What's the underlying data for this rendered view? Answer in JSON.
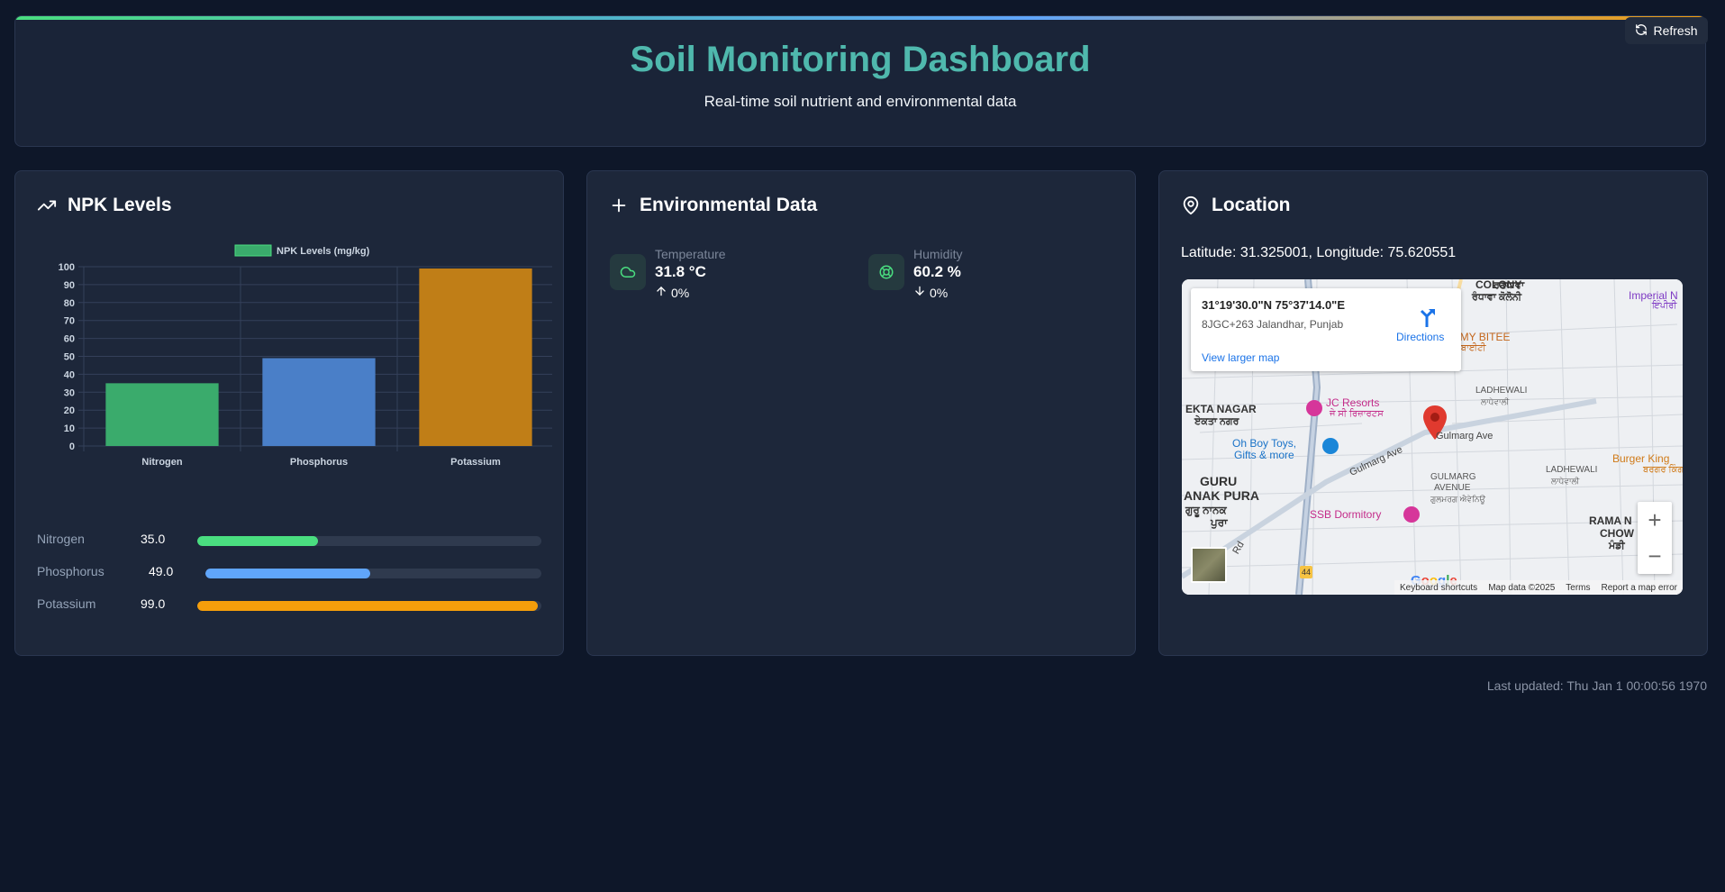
{
  "header": {
    "title": "Soil Monitoring Dashboard",
    "subtitle": "Real-time soil nutrient and environmental data",
    "refresh_label": "Refresh"
  },
  "npk_card": {
    "title": "NPK Levels",
    "items": [
      {
        "name": "Nitrogen",
        "value": "35.0",
        "percent": 35,
        "color": "#4ade80"
      },
      {
        "name": "Phosphorus",
        "value": "49.0",
        "percent": 49,
        "color": "#60a5fa"
      },
      {
        "name": "Potassium",
        "value": "99.0",
        "percent": 99,
        "color": "#f59e0b"
      }
    ]
  },
  "chart_data": {
    "type": "bar",
    "categories": [
      "Nitrogen",
      "Phosphorus",
      "Potassium"
    ],
    "series": [
      {
        "name": "NPK Levels (mg/kg)",
        "values": [
          35,
          49,
          99
        ],
        "colors": [
          "#3aab6c",
          "#4a7fc8",
          "#c07e17"
        ]
      }
    ],
    "yticks": [
      0,
      10,
      20,
      30,
      40,
      50,
      60,
      70,
      80,
      90,
      100
    ],
    "ylim": [
      0,
      100
    ],
    "grid": true,
    "legend": "top"
  },
  "env_card": {
    "title": "Environmental Data",
    "items": [
      {
        "label": "Temperature",
        "value": "31.8 °C",
        "trend": "0%",
        "direction": "up",
        "icon": "cloud-icon"
      },
      {
        "label": "Humidity",
        "value": "60.2 %",
        "trend": "0%",
        "direction": "down",
        "icon": "lifebuoy-icon"
      }
    ]
  },
  "location_card": {
    "title": "Location",
    "coordinates_text": "Latitude: 31.325001, Longitude: 75.620551",
    "map": {
      "info_coords": "31°19'30.0\"N 75°37'14.0\"E",
      "info_address": "8JGC+263 Jalandhar, Punjab",
      "directions_label": "Directions",
      "view_larger_label": "View larger map",
      "google_logo": "Google",
      "footer": [
        "Keyboard shortcuts",
        "Map data ©2025",
        "Terms",
        "Report a map error"
      ],
      "zoom_in": "+",
      "zoom_out": "−",
      "labels": {
        "colony": "COLONY",
        "colony_pa": "ਰੰਧਾਵਾ ਕੋਲੋਨੀ",
        "imperial": "Imperial N",
        "imperial_pa": "ਇੰਪੀਰੀ",
        "yummy": "YUMMY BITEE",
        "yummy_pa": "ਯੰਮੀ ਬਾਈਟੀ",
        "ladhewali1": "LADHEWALI",
        "ladhewali1_pa": "ਲਾਧੇਵਾਲੀ",
        "jc": "JC Resorts",
        "jc_pa": "ਜੇ ਸੀ ਰਿਜ਼ਾਰਟਸ",
        "ekta": "EKTA NAGAR",
        "ekta_pa": "ਏਕਤਾ ਨਗਰ",
        "ohboy1": "Oh Boy Toys,",
        "ohboy2": "Gifts & more",
        "gulmarg_ave": "Gulmarg Ave",
        "gulmarg_ave2": "Gulmarg Ave",
        "gulmarg_avenue1": "GULMARG",
        "gulmarg_avenue2": "AVENUE",
        "gulmarg_avenue_pa": "ਗੁਲਮਰਗ ਐਵੇਨਿਊ",
        "guru1": "GURU",
        "guru2": "ANAK PURA",
        "guru_pa1": "ਗੁਰੂ ਨਾਨਕ",
        "guru_pa2": "ਪੁਰਾ",
        "ssb": "SSB Dormitory",
        "burger": "Burger King",
        "burger_pa": "ਬਰਗਰ ਕਿੰਗ",
        "ladhewali2": "LADHEWALI",
        "ladhewali2_pa": "ਲਾਧੇਵਾਲੀ",
        "rama1": "RAMA N",
        "rama2": "CHOW",
        "rama_pa": "ਮੰਡੀ",
        "rd": "Rd",
        "hwy": "44",
        "top_cut": "ਰਣਧਾਵਾ"
      }
    }
  },
  "footer": {
    "last_updated": "Last updated: Thu Jan 1 00:00:56 1970"
  }
}
